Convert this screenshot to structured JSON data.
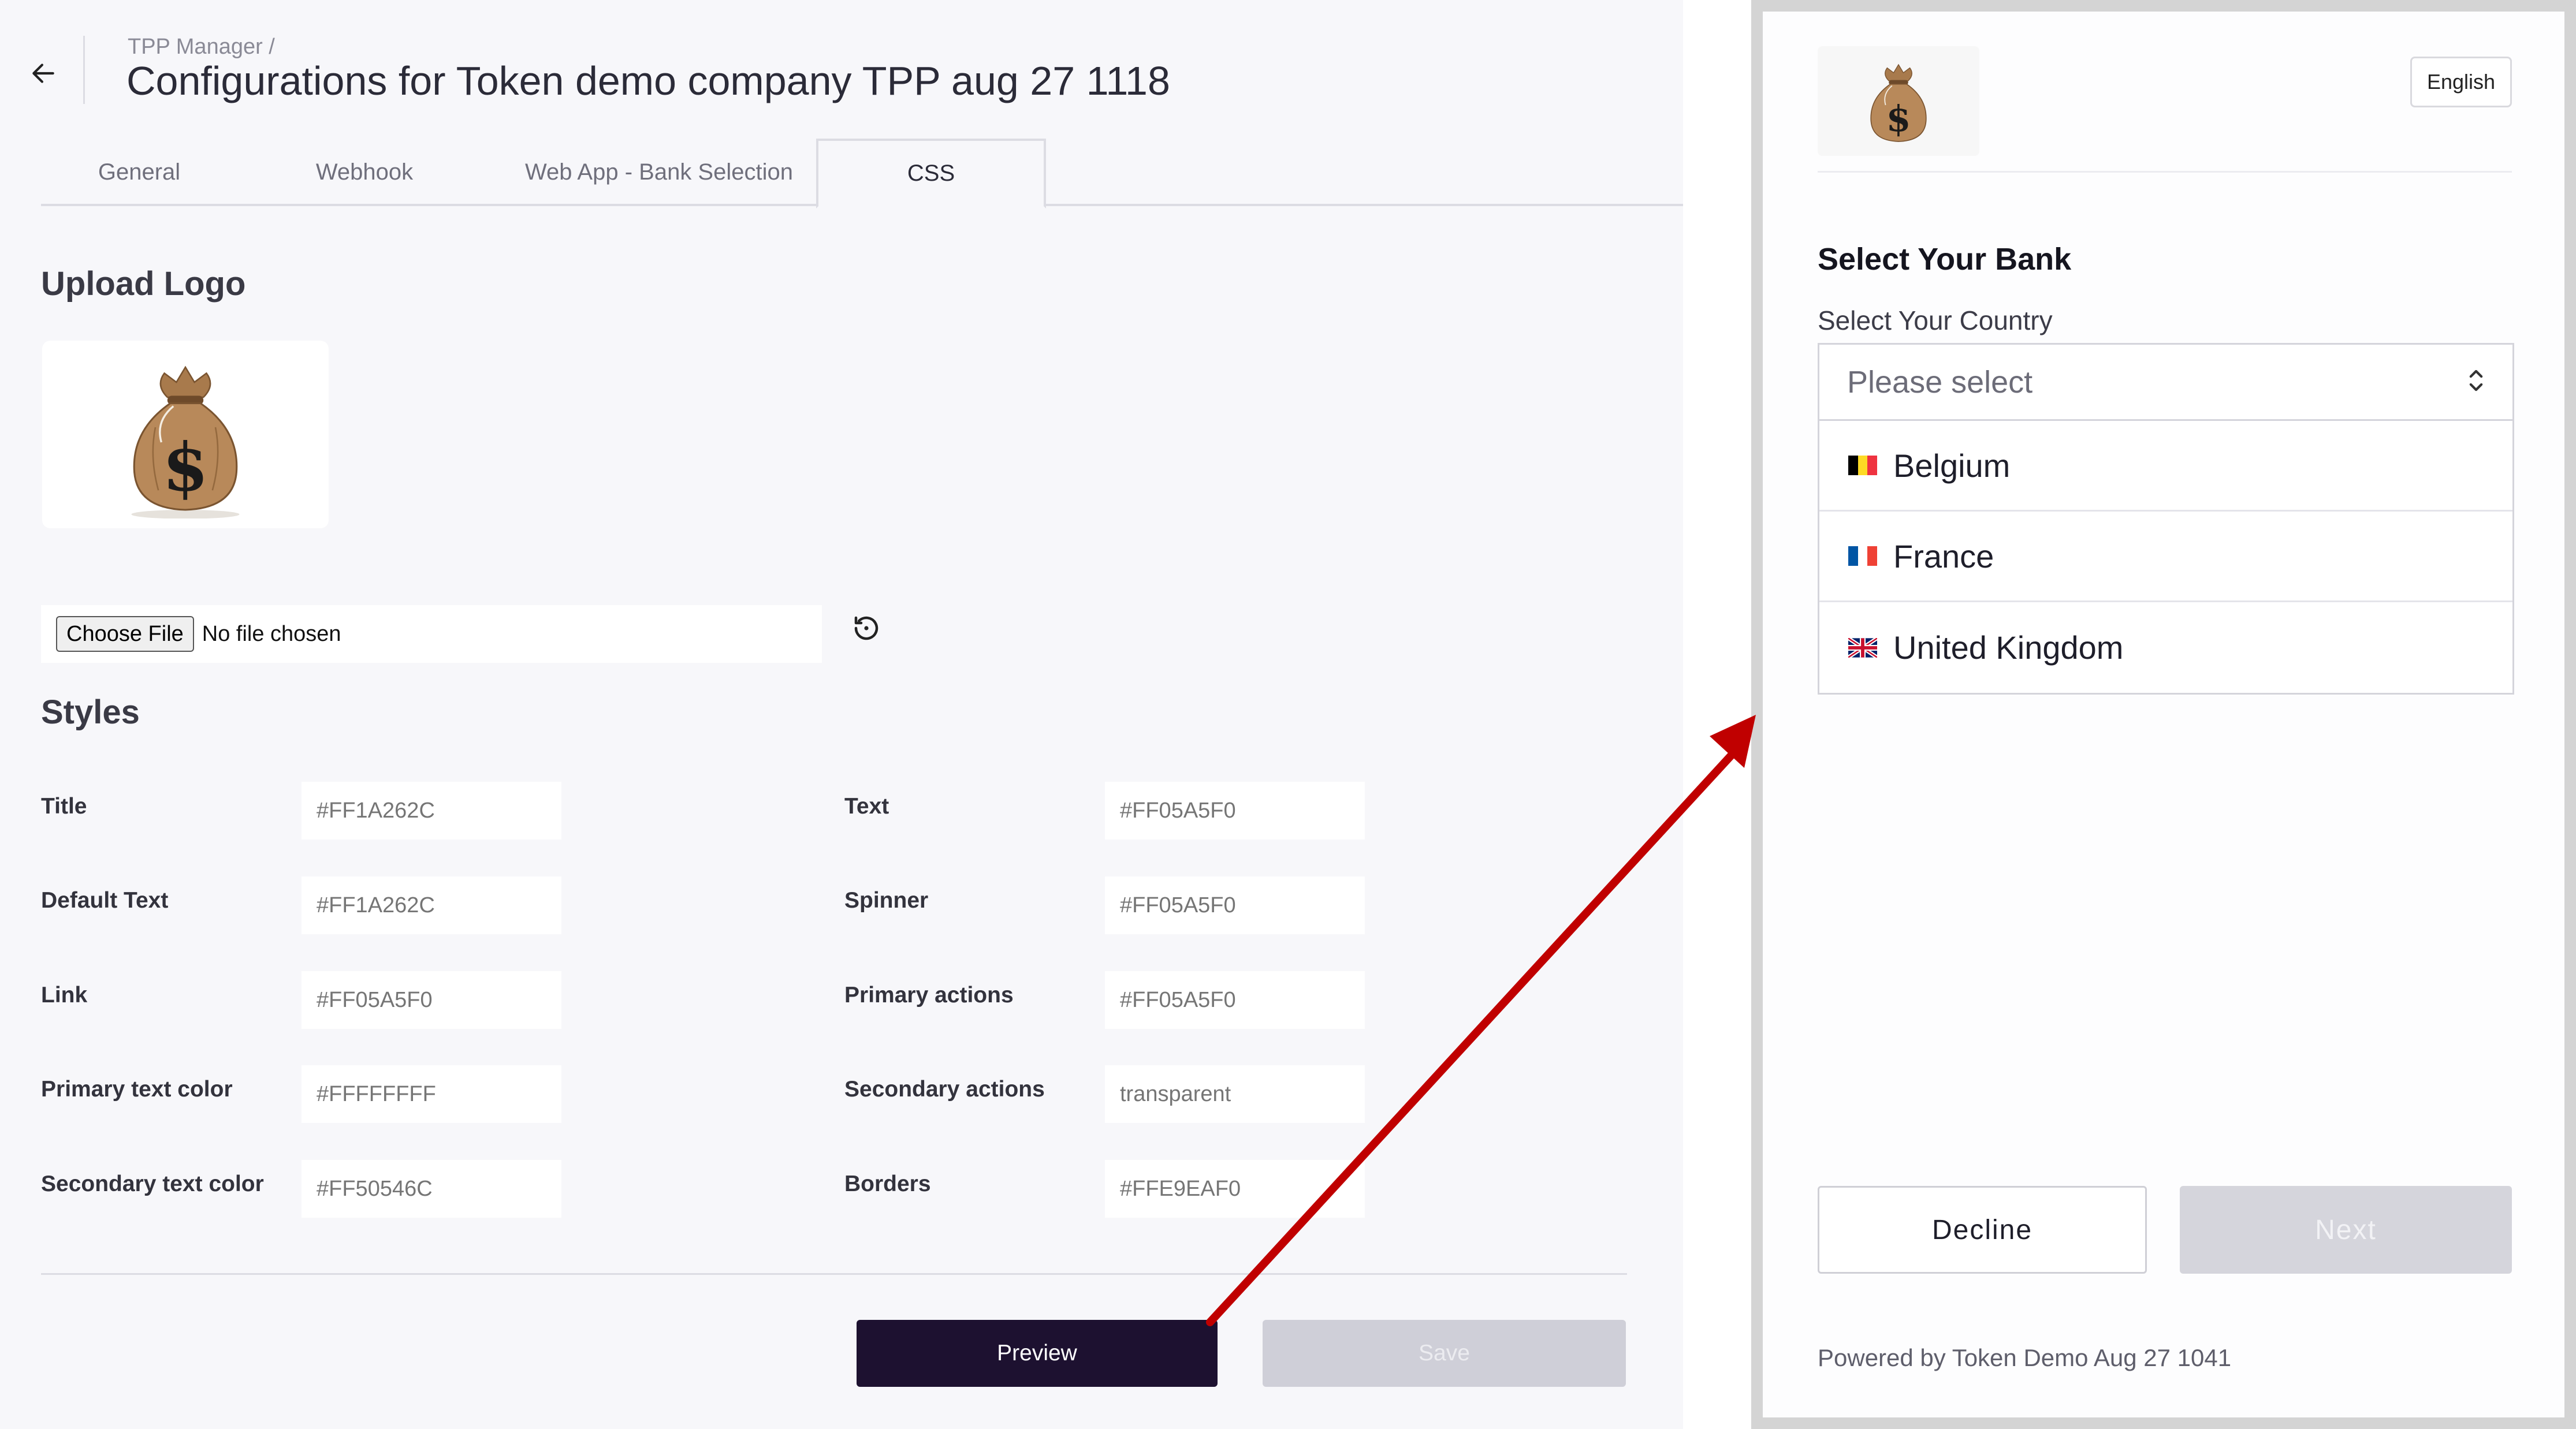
{
  "header": {
    "breadcrumb": "TPP Manager /",
    "title": "Configurations for Token demo company TPP aug 27 1118"
  },
  "tabs": [
    {
      "label": "General"
    },
    {
      "label": "Webhook"
    },
    {
      "label": "Web App - Bank Selection"
    },
    {
      "label": "CSS"
    }
  ],
  "upload": {
    "section_title": "Upload Logo",
    "choose_label": "Choose File",
    "file_status": "No file chosen"
  },
  "styles": {
    "section_title": "Styles",
    "fields": [
      {
        "label": "Title",
        "value": "#FF1A262C"
      },
      {
        "label": "Default Text",
        "value": "#FF1A262C"
      },
      {
        "label": "Link",
        "value": "#FF05A5F0"
      },
      {
        "label": "Primary text color",
        "value": "#FFFFFFFF"
      },
      {
        "label": "Secondary text color",
        "value": "#FF50546C"
      },
      {
        "label": "Text",
        "value": "#FF05A5F0"
      },
      {
        "label": "Spinner",
        "value": "#FF05A5F0"
      },
      {
        "label": "Primary actions",
        "value": "#FF05A5F0"
      },
      {
        "label": "Secondary actions",
        "value": "transparent"
      },
      {
        "label": "Borders",
        "value": "#FFE9EAF0"
      }
    ]
  },
  "actions": {
    "preview_label": "Preview",
    "save_label": "Save"
  },
  "preview": {
    "language": "English",
    "title": "Select Your Bank",
    "country_label": "Select Your Country",
    "select_placeholder": "Please select",
    "countries": [
      {
        "name": "Belgium",
        "flag": "belgium-flag-icon"
      },
      {
        "name": "France",
        "flag": "france-flag-icon"
      },
      {
        "name": "United Kingdom",
        "flag": "uk-flag-icon"
      }
    ],
    "decline_label": "Decline",
    "next_label": "Next",
    "powered_by": "Powered by Token Demo Aug 27 1041"
  },
  "colors": {
    "primary_button": "#1d1130",
    "disabled_button": "#cfcfd8",
    "annotation_arrow": "#c00000"
  }
}
